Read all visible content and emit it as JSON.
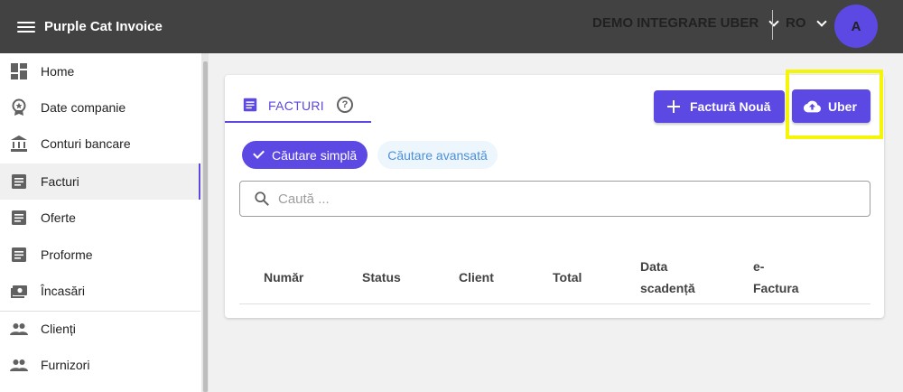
{
  "header": {
    "app_title": "Purple Cat Invoice",
    "organization": "DEMO INTEGRARE UBER",
    "language": "RO",
    "avatar_initial": "A",
    "icons": {
      "menu": "hamburger-icon",
      "org_dropdown": "chevron-down-icon",
      "lang_dropdown": "chevron-down-icon"
    }
  },
  "sidebar": {
    "items": [
      {
        "label": "Home",
        "icon": "dashboard-icon"
      },
      {
        "label": "Date companie",
        "icon": "badge-icon"
      },
      {
        "label": "Conturi bancare",
        "icon": "bank-icon"
      },
      {
        "label": "Facturi",
        "icon": "document-icon",
        "active": true
      },
      {
        "label": "Oferte",
        "icon": "document-icon"
      },
      {
        "label": "Proforme",
        "icon": "document-icon"
      },
      {
        "label": "Încasări",
        "icon": "cash-icon"
      },
      {
        "label": "Clienți",
        "icon": "people-icon"
      },
      {
        "label": "Furnizori",
        "icon": "people-icon"
      }
    ]
  },
  "main": {
    "tab_label": "FACTURI",
    "help_symbol": "?",
    "new_invoice_label": "Factură Nouă",
    "uber_label": "Uber",
    "search_modes": {
      "simple": "Căutare simplă",
      "advanced": "Căutare avansată"
    },
    "search_placeholder": "Caută ...",
    "table_headers": [
      "Număr",
      "Status",
      "Client",
      "Total",
      "Data scadență",
      "e-Factura"
    ]
  },
  "colors": {
    "accent": "#5c48e2",
    "topbar": "#424242",
    "highlight": "#f5f50a",
    "chip_advanced_bg": "#eef6fd",
    "chip_advanced_text": "#4a90d9"
  }
}
